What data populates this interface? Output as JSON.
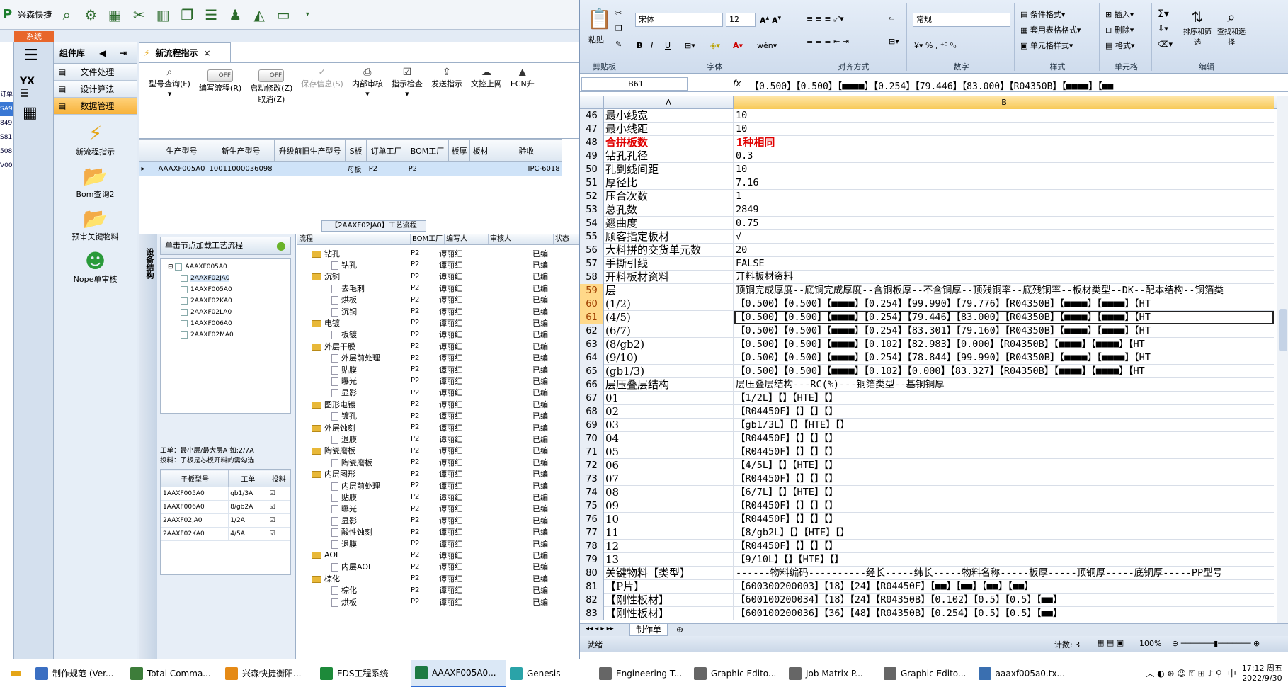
{
  "app": {
    "brand": "兴森快捷",
    "sys_tab": "系统",
    "nav_title": "组件库",
    "nav_groups": [
      "文件处理",
      "设计算法",
      "数据管理"
    ],
    "nav_items": [
      "新流程指示",
      "Bom查询2",
      "预审关键物料",
      "Nope单审核"
    ],
    "doc_tab": "新流程指示",
    "ribbon": {
      "model_query": "型号查询(F)",
      "edit_flow": "编写流程(R)",
      "start_modify": "启动修改(Z)",
      "cancel": "取消(Z)",
      "save_info": "保存信息(S)",
      "internal_review": "内部审核",
      "indicator_check": "指示检查",
      "send_indicator": "发送指示",
      "file_upload": "文控上网",
      "ecn": "ECN升",
      "toggle_off": "OFF"
    },
    "grid_headers": [
      "生产型号",
      "新生产型号",
      "升级前旧生产型号",
      "S板",
      "订单工厂",
      "BOM工厂",
      "板厚",
      "板材",
      "验收"
    ],
    "grid_row": [
      "AAAXF005A0",
      "10011000036098",
      "",
      "母板",
      "P2",
      "P2",
      "",
      "",
      "IPC-6018"
    ],
    "flow_title": "【2AAXF02JA0】工艺流程",
    "tree_panel_title": "单击节点加载工艺流程",
    "vert_tab": "设备结构",
    "tree_root": "AAAXF005A0",
    "tree_children": [
      "2AAXF02JA0",
      "1AAXF005A0",
      "2AAXF02KA0",
      "2AAXF02LA0",
      "1AAXF006A0",
      "2AAXF02MA0"
    ],
    "note1": "工单：最小层/最大层A 如:2/7A",
    "note2": "投料：子板是芯板开料的需勾选",
    "sub_headers": [
      "子板型号",
      "工单",
      "投料"
    ],
    "sub_rows": [
      [
        "1AAXF005A0",
        "gb1/3A"
      ],
      [
        "1AAXF006A0",
        "8/gb2A"
      ],
      [
        "2AAXF02JA0",
        "1/2A"
      ],
      [
        "2AAXF02KA0",
        "4/5A"
      ]
    ],
    "flow_headers": [
      "流程",
      "BOM工厂",
      "编写人",
      "审核人",
      "状态"
    ],
    "flow_rows": [
      {
        "name": "钻孔",
        "lvl": 0
      },
      {
        "name": "钻孔",
        "lvl": 1
      },
      {
        "name": "沉铜",
        "lvl": 0
      },
      {
        "name": "去毛刺",
        "lvl": 1
      },
      {
        "name": "烘板",
        "lvl": 1
      },
      {
        "name": "沉铜",
        "lvl": 1
      },
      {
        "name": "电镀",
        "lvl": 0
      },
      {
        "name": "板镀",
        "lvl": 1
      },
      {
        "name": "外层干膜",
        "lvl": 0
      },
      {
        "name": "外层前处理",
        "lvl": 1
      },
      {
        "name": "贴膜",
        "lvl": 1
      },
      {
        "name": "曝光",
        "lvl": 1
      },
      {
        "name": "显影",
        "lvl": 1
      },
      {
        "name": "图形电镀",
        "lvl": 0
      },
      {
        "name": "镀孔",
        "lvl": 1
      },
      {
        "name": "外层蚀刻",
        "lvl": 0
      },
      {
        "name": "退膜",
        "lvl": 1
      },
      {
        "name": "陶瓷磨板",
        "lvl": 0
      },
      {
        "name": "陶瓷磨板",
        "lvl": 1
      },
      {
        "name": "内层图形",
        "lvl": 0
      },
      {
        "name": "内层前处理",
        "lvl": 1
      },
      {
        "name": "贴膜",
        "lvl": 1
      },
      {
        "name": "曝光",
        "lvl": 1
      },
      {
        "name": "显影",
        "lvl": 1
      },
      {
        "name": "酸性蚀刻",
        "lvl": 1
      },
      {
        "name": "退膜",
        "lvl": 1
      },
      {
        "name": "AOI",
        "lvl": 0
      },
      {
        "name": "内层AOI",
        "lvl": 1
      },
      {
        "name": "棕化",
        "lvl": 0
      },
      {
        "name": "棕化",
        "lvl": 1
      },
      {
        "name": "烘板",
        "lvl": 1
      }
    ],
    "flow_bom": "P2",
    "flow_writer": "谭丽红",
    "flow_status": "已编"
  },
  "excel": {
    "font_name": "宋体",
    "font_size": "12",
    "num_format": "常规",
    "groups": [
      "剪贴板",
      "字体",
      "对齐方式",
      "数字",
      "样式",
      "单元格",
      "编辑"
    ],
    "paste": "粘贴",
    "styles": [
      "条件格式",
      "套用表格格式",
      "单元格样式"
    ],
    "cells_btns": [
      "插入",
      "删除",
      "格式"
    ],
    "edit_btns": [
      "排序和筛选",
      "查找和选择"
    ],
    "name_box": "B61",
    "formula": "【0.500】【0.500】【■■■■】【0.254】【79.446】【83.000】【R04350B】【■■■■】【■■",
    "col_a": "A",
    "col_b": "B",
    "rows": [
      {
        "n": "46",
        "a": "最小线宽",
        "b": "10"
      },
      {
        "n": "47",
        "a": "最小线距",
        "b": "10"
      },
      {
        "n": "48",
        "a": "合拼板数",
        "b": "1种相同",
        "red": true
      },
      {
        "n": "49",
        "a": "钻孔孔径",
        "b": "0.3"
      },
      {
        "n": "50",
        "a": "孔到线间距",
        "b": "10"
      },
      {
        "n": "51",
        "a": "厚径比",
        "b": "7.16"
      },
      {
        "n": "52",
        "a": "压合次数",
        "b": "1"
      },
      {
        "n": "53",
        "a": "总孔数",
        "b": "2849"
      },
      {
        "n": "54",
        "a": "翘曲度",
        "b": "0.75"
      },
      {
        "n": "55",
        "a": "顾客指定板材",
        "b": "√"
      },
      {
        "n": "56",
        "a": "大料拼的交货单元数",
        "b": "20"
      },
      {
        "n": "57",
        "a": "手撕引线",
        "b": "FALSE"
      },
      {
        "n": "58",
        "a": "开料板材资料",
        "b": "开料板材资料"
      },
      {
        "n": "59",
        "a": "层",
        "b": "顶铜完成厚度--底铜完成厚度--含铜板厚--不含铜厚--顶残铜率--底残铜率--板材类型--DK--配本结构--铜箔类",
        "hl": true
      },
      {
        "n": "60",
        "a": "(1/2)",
        "b": "【0.500】【0.500】【■■■■】【0.254】【99.990】【79.776】【R04350B】【■■■■】【■■■■】【HT",
        "hl": true
      },
      {
        "n": "61",
        "a": "(4/5)",
        "b": "【0.500】【0.500】【■■■■】【0.254】【79.446】【83.000】【R04350B】【■■■■】【■■■■】【HT",
        "hl": true
      },
      {
        "n": "62",
        "a": "(6/7)",
        "b": "【0.500】【0.500】【■■■■】【0.254】【83.301】【79.160】【R04350B】【■■■■】【■■■■】【HT"
      },
      {
        "n": "63",
        "a": "(8/gb2)",
        "b": "【0.500】【0.500】【■■■■】【0.102】【82.983】【0.000】【R04350B】【■■■■】【■■■■】【HT"
      },
      {
        "n": "64",
        "a": "(9/10)",
        "b": "【0.500】【0.500】【■■■■】【0.254】【78.844】【99.990】【R04350B】【■■■■】【■■■■】【HT"
      },
      {
        "n": "65",
        "a": "(gb1/3)",
        "b": "【0.500】【0.500】【■■■■】【0.102】【0.000】【83.327】【R04350B】【■■■■】【■■■■】【HT"
      },
      {
        "n": "66",
        "a": "层压叠层结构",
        "b": "层压叠层结构---RC(%)---铜箔类型--基铜铜厚"
      },
      {
        "n": "67",
        "a": "01",
        "b": "【1/2L】【】【HTE】【】"
      },
      {
        "n": "68",
        "a": "02",
        "b": "【R04450F】【】【】【】"
      },
      {
        "n": "69",
        "a": "03",
        "b": "【gb1/3L】【】【HTE】【】"
      },
      {
        "n": "70",
        "a": "04",
        "b": "【R04450F】【】【】【】"
      },
      {
        "n": "71",
        "a": "05",
        "b": "【R04450F】【】【】【】"
      },
      {
        "n": "72",
        "a": "06",
        "b": "【4/5L】【】【HTE】【】"
      },
      {
        "n": "73",
        "a": "07",
        "b": "【R04450F】【】【】【】"
      },
      {
        "n": "74",
        "a": "08",
        "b": "【6/7L】【】【HTE】【】"
      },
      {
        "n": "75",
        "a": "09",
        "b": "【R04450F】【】【】【】"
      },
      {
        "n": "76",
        "a": "10",
        "b": "【R04450F】【】【】【】"
      },
      {
        "n": "77",
        "a": "11",
        "b": "【8/gb2L】【】【HTE】【】"
      },
      {
        "n": "78",
        "a": "12",
        "b": "【R04450F】【】【】【】"
      },
      {
        "n": "79",
        "a": "13",
        "b": "【9/10L】【】【HTE】【】"
      },
      {
        "n": "80",
        "a": "关键物料【类型】",
        "b": "------物料编码----------经长-----纬长-----物料名称-----板厚-----顶铜厚-----底铜厚-----PP型号"
      },
      {
        "n": "81",
        "a": "【P片】",
        "b": "【600300200003】【18】【24】【R04450F】【■■】【■■】【■■】【■■】"
      },
      {
        "n": "82",
        "a": "【刚性板材】",
        "b": "【600100200034】【18】【24】【R04350B】【0.102】【0.5】【0.5】【■■】"
      },
      {
        "n": "83",
        "a": "【刚性板材】",
        "b": "【600100200036】【36】【48】【R04350B】【0.254】【0.5】【0.5】【■■】"
      }
    ],
    "sheet_tab": "制作单",
    "status_ready": "就绪",
    "status_count": "计数: 3",
    "zoom": "100%"
  },
  "taskbar": {
    "items": [
      "制作规范 (Ver...",
      "Total Comma...",
      "兴森快捷衡阳...",
      "EDS工程系统",
      "AAAXF005A0...",
      "Genesis",
      "Engineering T...",
      "Graphic Edito...",
      "Job Matrix P...",
      "Graphic Edito...",
      "aaaxf005a0.tx..."
    ],
    "ime": "中",
    "time": "17:12 周五",
    "date": "2022/9/30"
  }
}
